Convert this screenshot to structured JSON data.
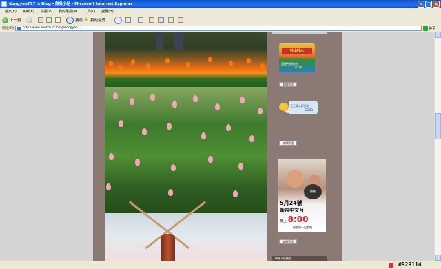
{
  "window": {
    "title": "dongyeh777 's Blog - 無名小站 - Microsoft Internet Explorer"
  },
  "menu": {
    "items": [
      "檔案(F)",
      "編輯(E)",
      "檢視(V)",
      "我的最愛(A)",
      "工具(T)",
      "說明(H)"
    ]
  },
  "toolbar": {
    "back_label": "上一頁",
    "search_label": "搜尋",
    "favorites_label": "我的最愛"
  },
  "address": {
    "label": "網址(D)",
    "url": "http://www.wretch.cc/blog/dongyeh777",
    "go_label": "移至"
  },
  "sidebar": {
    "manage_label": "編輯管理",
    "widget1": {
      "badge": "好山好水",
      "label": "回總台總統府",
      "number": "2018"
    },
    "widget2": {
      "label": "天天開心好好吃",
      "number": "2281"
    },
    "ad": {
      "dark_text": "總統",
      "date": "5月24號",
      "channel": "衛視中文台",
      "time_prefix": "晚上",
      "time": "8:00",
      "tag": "把我們一起看吧"
    },
    "section_title": "參觀人氣統計"
  },
  "status": {
    "id_text": "#929114"
  },
  "colors": {
    "frame": "#8a7a73",
    "titlebar": "#0a56c8",
    "page_bg": "#d4d4d4"
  },
  "icons": [
    "back-icon",
    "forward-icon",
    "refresh-icon",
    "home-icon",
    "search-icon",
    "favorites-icon",
    "media-icon",
    "mail-icon",
    "print-icon"
  ]
}
